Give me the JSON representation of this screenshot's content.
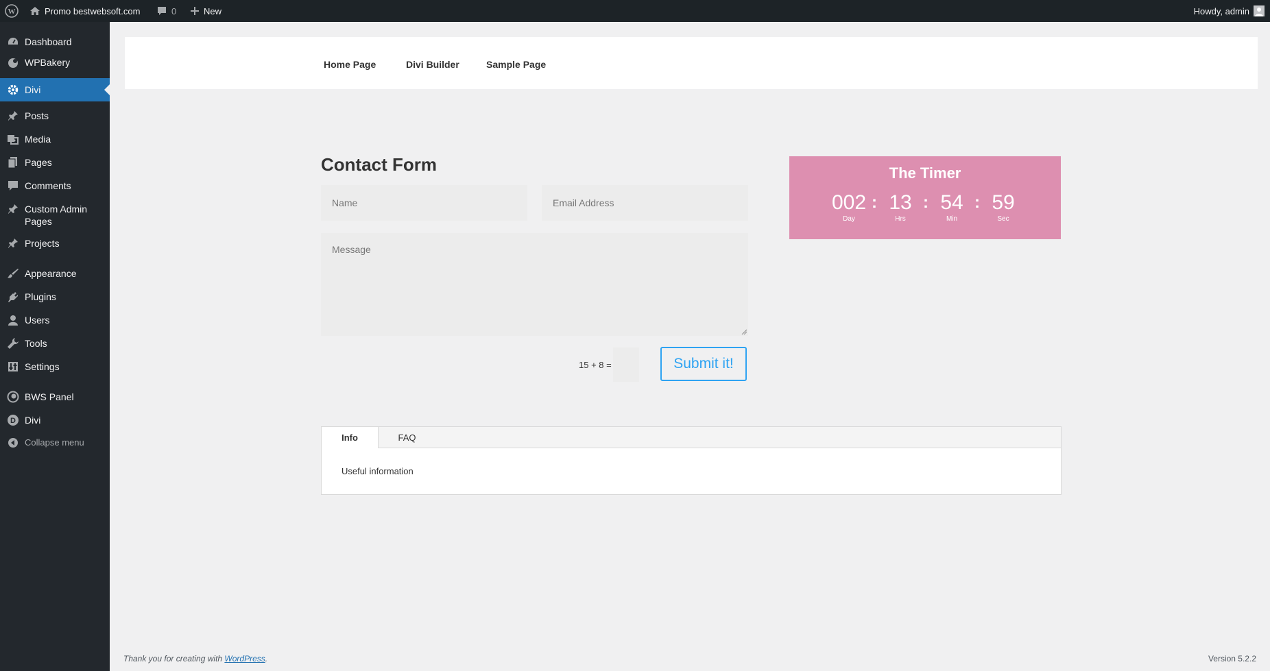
{
  "admin_bar": {
    "site_name": "Promo bestwebsoft.com",
    "comments_count": "0",
    "new_label": "New",
    "greeting": "Howdy, admin"
  },
  "sidebar": {
    "items": [
      {
        "label": "Dashboard",
        "icon": "dashboard-icon"
      },
      {
        "label": "WPBakery",
        "icon": "wpbakery-icon"
      },
      {
        "label": "Divi",
        "icon": "gear-icon",
        "current": true
      },
      {
        "label": "Posts",
        "icon": "pin-icon"
      },
      {
        "label": "Media",
        "icon": "media-icon"
      },
      {
        "label": "Pages",
        "icon": "pages-icon"
      },
      {
        "label": "Comments",
        "icon": "comment-icon"
      },
      {
        "label": "Custom Admin Pages",
        "icon": "pin-icon"
      },
      {
        "label": "Projects",
        "icon": "pin-icon"
      },
      {
        "label": "Appearance",
        "icon": "brush-icon"
      },
      {
        "label": "Plugins",
        "icon": "plugin-icon"
      },
      {
        "label": "Users",
        "icon": "user-icon"
      },
      {
        "label": "Tools",
        "icon": "wrench-icon"
      },
      {
        "label": "Settings",
        "icon": "settings-icon"
      },
      {
        "label": "BWS Panel",
        "icon": "bws-icon"
      },
      {
        "label": "Divi",
        "icon": "divi-logo-icon"
      }
    ],
    "collapse_label": "Collapse menu"
  },
  "site_nav": {
    "links": [
      "Home Page",
      "Divi Builder",
      "Sample Page"
    ]
  },
  "contact_form": {
    "title": "Contact Form",
    "name_placeholder": "Name",
    "email_placeholder": "Email Address",
    "message_placeholder": "Message",
    "captcha_question": "15 + 8 =",
    "submit_label": "Submit it!"
  },
  "timer": {
    "title": "The Timer",
    "day": {
      "value": "002",
      "label": "Day"
    },
    "hrs": {
      "value": "13",
      "label": "Hrs"
    },
    "min": {
      "value": "54",
      "label": "Min"
    },
    "sec": {
      "value": "59",
      "label": "Sec"
    },
    "separator": ":",
    "background_color": "#dd8fb0"
  },
  "tabs": {
    "items": [
      "Info",
      "FAQ"
    ],
    "active": "Info",
    "content": "Useful information"
  },
  "footer": {
    "thanks_prefix": "Thank you for creating with ",
    "thanks_link": "WordPress",
    "thanks_suffix": ".",
    "version": "Version 5.2.2"
  },
  "colors": {
    "admin_bar_bg": "#1d2327",
    "sidebar_bg": "#23282d",
    "current_item_bg": "#2271b1",
    "button_accent": "#2ea3f2"
  }
}
